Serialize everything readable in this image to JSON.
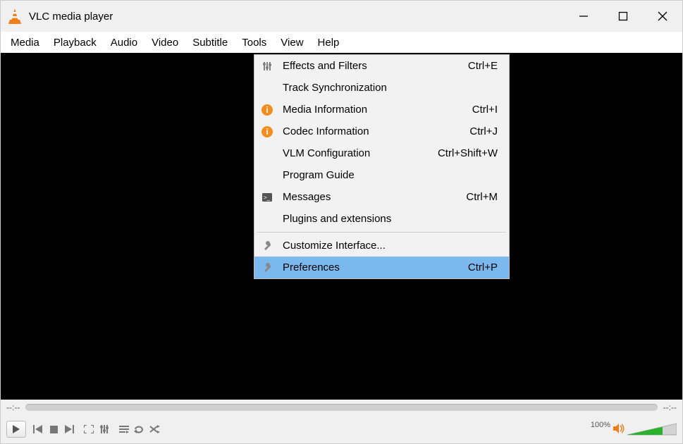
{
  "title": "VLC media player",
  "menus": {
    "media": "Media",
    "playback": "Playback",
    "audio": "Audio",
    "video": "Video",
    "subtitle": "Subtitle",
    "tools": "Tools",
    "view": "View",
    "help": "Help"
  },
  "tools_menu": {
    "effects": {
      "label": "Effects and Filters",
      "accel": "Ctrl+E"
    },
    "sync": {
      "label": "Track Synchronization",
      "accel": ""
    },
    "media_info": {
      "label": "Media Information",
      "accel": "Ctrl+I"
    },
    "codec_info": {
      "label": "Codec Information",
      "accel": "Ctrl+J"
    },
    "vlm": {
      "label": "VLM Configuration",
      "accel": "Ctrl+Shift+W"
    },
    "guide": {
      "label": "Program Guide",
      "accel": ""
    },
    "messages": {
      "label": "Messages",
      "accel": "Ctrl+M"
    },
    "plugins": {
      "label": "Plugins and extensions",
      "accel": ""
    },
    "customize": {
      "label": "Customize Interface...",
      "accel": ""
    },
    "prefs": {
      "label": "Preferences",
      "accel": "Ctrl+P"
    }
  },
  "timeline": {
    "elapsed": "--:--",
    "remaining": "--:--"
  },
  "volume": {
    "percent_label": "100%",
    "value": 100
  }
}
